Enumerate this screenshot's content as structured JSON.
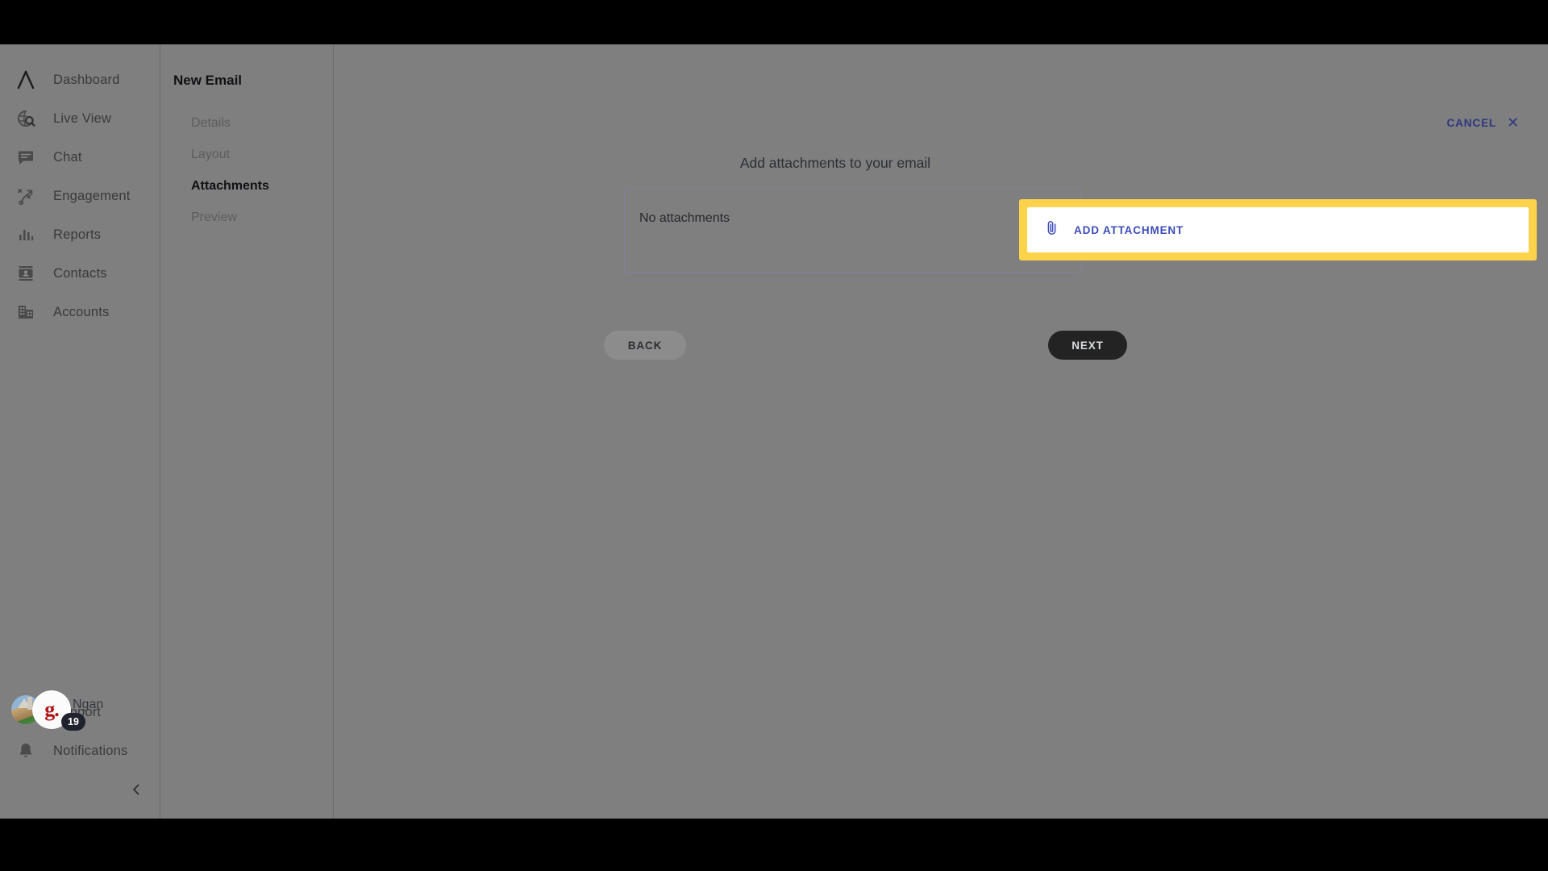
{
  "colors": {
    "highlight_yellow": "#fcd34a",
    "arrow_yellow": "#fbcf4d",
    "accent_blue": "#3b4bb8",
    "cancel_blue": "#31397e",
    "next_dark": "#232323",
    "brand_red": "#b01116"
  },
  "sidebar": {
    "items": [
      {
        "label": "Dashboard",
        "icon": "lambda-logo-icon"
      },
      {
        "label": "Live View",
        "icon": "globe-search-icon"
      },
      {
        "label": "Chat",
        "icon": "chat-bubble-icon"
      },
      {
        "label": "Engagement",
        "icon": "playbook-icon"
      },
      {
        "label": "Reports",
        "icon": "bar-chart-icon"
      },
      {
        "label": "Contacts",
        "icon": "contact-card-icon"
      },
      {
        "label": "Accounts",
        "icon": "building-icon"
      }
    ],
    "bottom_items": [
      {
        "label": "Support",
        "icon": "help-circle-icon"
      },
      {
        "label": "Notifications",
        "icon": "bell-icon"
      }
    ],
    "user": {
      "name": "Ngan",
      "brand_initial": "g.",
      "notification_count": "19"
    },
    "collapse_icon": "chevron-left-icon"
  },
  "wizard": {
    "title": "New Email",
    "steps": [
      {
        "label": "Details",
        "active": false
      },
      {
        "label": "Layout",
        "active": false
      },
      {
        "label": "Attachments",
        "active": true
      },
      {
        "label": "Preview",
        "active": false
      }
    ]
  },
  "main": {
    "cancel_label": "CANCEL",
    "cancel_icon": "close-icon",
    "heading": "Add attachments to your email",
    "attachments_empty_text": "No attachments",
    "add_attachment_label": "ADD ATTACHMENT",
    "add_attachment_icon": "paperclip-icon",
    "back_label": "BACK",
    "next_label": "NEXT"
  },
  "annotation": {
    "arrow_icon": "curved-left-arrow-icon",
    "points_to": "ADD ATTACHMENT"
  }
}
